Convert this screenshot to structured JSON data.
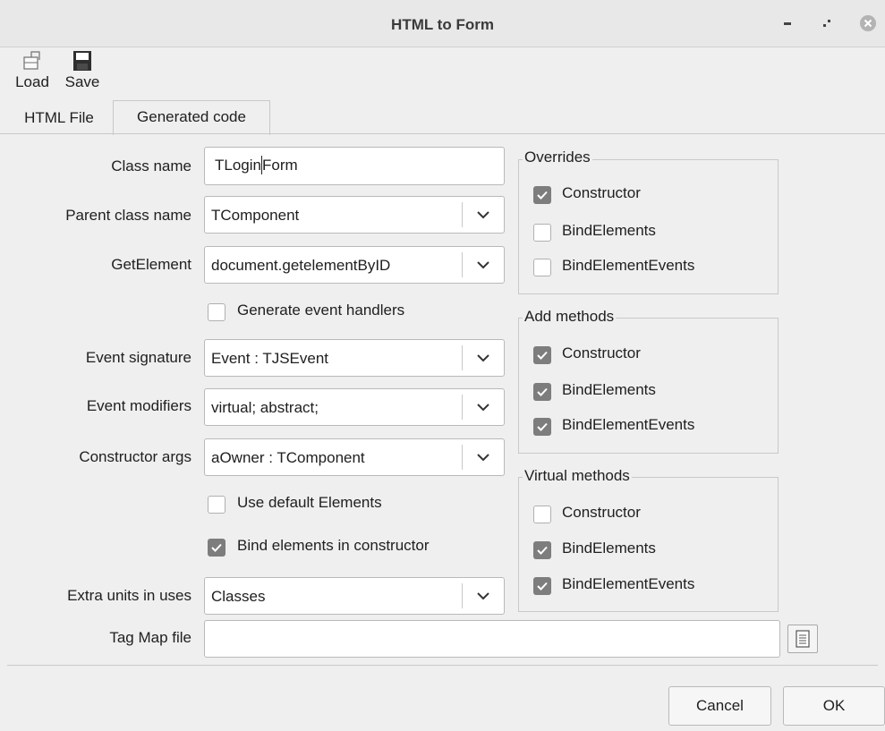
{
  "window": {
    "title": "HTML to Form",
    "controls": [
      "minimize-icon",
      "restore-icon",
      "close-icon"
    ]
  },
  "toolbar": {
    "load_label": "Load",
    "save_label": "Save",
    "load_icon": "open-folder-icon",
    "save_icon": "floppy-disk-icon"
  },
  "tabs": [
    {
      "label": "HTML File",
      "active": false
    },
    {
      "label": "Generated code",
      "active": true
    }
  ],
  "form": {
    "class_name": {
      "label": "Class name",
      "value_before_caret": "TLogin",
      "value_after_caret": "Form"
    },
    "parent_class_name": {
      "label": "Parent class name",
      "value": "TComponent"
    },
    "get_element": {
      "label": "GetElement",
      "value": "document.getelementByID"
    },
    "generate_event_handlers": {
      "label": "Generate event handlers",
      "checked": false
    },
    "event_signature": {
      "label": "Event signature",
      "value": "Event : TJSEvent"
    },
    "event_modifiers": {
      "label": "Event modifiers",
      "value": "virtual; abstract;"
    },
    "constructor_args": {
      "label": "Constructor args",
      "value": "aOwner : TComponent"
    },
    "use_default_elements": {
      "label": "Use default Elements",
      "checked": false
    },
    "bind_elements_in_constructor": {
      "label": "Bind elements in constructor",
      "checked": true
    },
    "extra_units": {
      "label": "Extra units in uses",
      "value": "Classes"
    },
    "tag_map_file": {
      "label": "Tag Map file",
      "value": "",
      "browse_icon": "file-browse-icon"
    }
  },
  "overrides": {
    "title": "Overrides",
    "items": [
      {
        "label": "Constructor",
        "checked": true
      },
      {
        "label": "BindElements",
        "checked": false
      },
      {
        "label": "BindElementEvents",
        "checked": false
      }
    ]
  },
  "add_methods": {
    "title": "Add methods",
    "items": [
      {
        "label": "Constructor",
        "checked": true
      },
      {
        "label": "BindElements",
        "checked": true
      },
      {
        "label": "BindElementEvents",
        "checked": true
      }
    ]
  },
  "virtual_methods": {
    "title": "Virtual methods",
    "items": [
      {
        "label": "Constructor",
        "checked": false
      },
      {
        "label": "BindElements",
        "checked": true
      },
      {
        "label": "BindElementEvents",
        "checked": true
      }
    ]
  },
  "buttons": {
    "cancel": "Cancel",
    "ok": "OK"
  },
  "colors": {
    "window_bg": "#efefef",
    "checked_box": "#7d7d7d",
    "close_button": "#b3b3b3"
  }
}
